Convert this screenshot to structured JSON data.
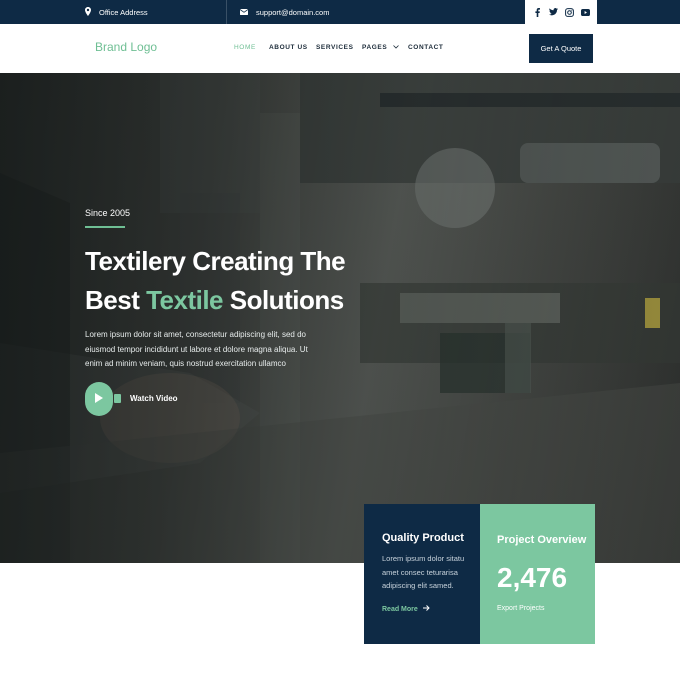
{
  "topbar": {
    "address": "Office Address",
    "email": "support@domain.com",
    "social": [
      "facebook-icon",
      "twitter-icon",
      "instagram-icon",
      "youtube-icon"
    ]
  },
  "nav": {
    "logo": "Brand Logo",
    "items": [
      {
        "label": "HOME",
        "active": true
      },
      {
        "label": "ABOUT US",
        "active": false
      },
      {
        "label": "SERVICES",
        "active": false
      },
      {
        "label": "PAGES",
        "active": false
      },
      {
        "label": "CONTACT",
        "active": false
      }
    ],
    "cta": "Get A Quote"
  },
  "hero": {
    "since": "Since 2005",
    "headline_line1": "Textilery Creating The",
    "headline_pre": "Best ",
    "headline_accent": "Textile",
    "headline_post": " Solutions",
    "description": "Lorem ipsum dolor sit amet, consectetur adipiscing elit, sed do eiusmod tempor incididunt ut labore et dolore magna aliqua. Ut enim ad minim veniam, quis nostrud exercitation ullamco",
    "watch_label": "Watch Video"
  },
  "cards": {
    "quality": {
      "title": "Quality Product",
      "text": "Lorem ipsum dolor sitatu amet consec teturarisa adipiscing elit samed.",
      "link": "Read More"
    },
    "overview": {
      "title": "Project Overview",
      "number": "2,476",
      "subtitle": "Export Projects"
    }
  },
  "colors": {
    "navy": "#0e2a45",
    "accent": "#7cc7a0"
  }
}
